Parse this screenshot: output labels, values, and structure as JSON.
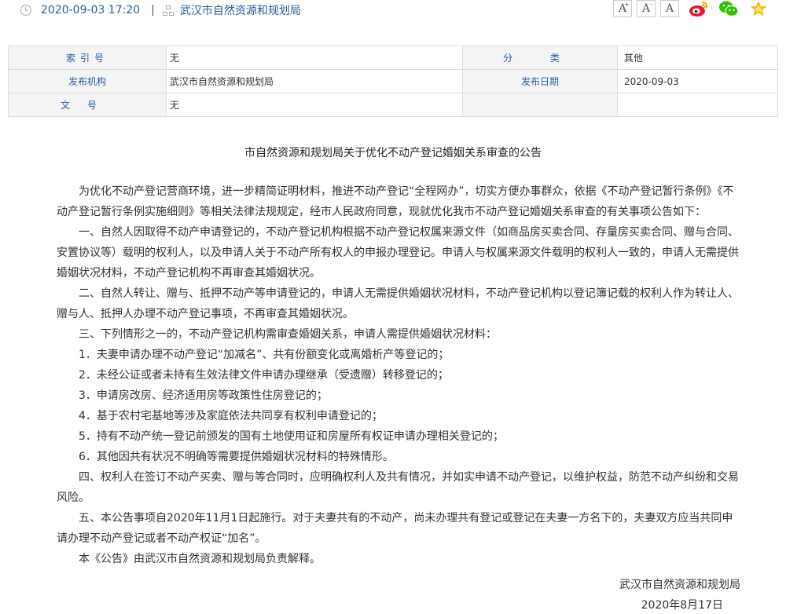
{
  "header": {
    "datetime": "2020-09-03 17:20",
    "separator": "|",
    "publisher": "武汉市自然资源和规划局",
    "font_buttons": [
      {
        "glyph": "A",
        "mark": "+"
      },
      {
        "glyph": "A",
        "mark": "-"
      },
      {
        "glyph": "A",
        "mark": ""
      }
    ],
    "share_icons": [
      "weibo-icon",
      "wechat-icon",
      "favorite-star-icon"
    ],
    "colors": {
      "weibo": "#e6162d",
      "wechat": "#2dc100",
      "star": "#f5b800"
    }
  },
  "info": {
    "index_label": "索引号",
    "index_value": "无",
    "category_label": "分 类",
    "category_value": "其他",
    "issuer_label": "发布机构",
    "issuer_value": "武汉市自然资源和规划局",
    "date_label": "发布日期",
    "date_value": "2020-09-03",
    "docno_label": "文号",
    "docno_value": "无"
  },
  "article": {
    "title": "市自然资源和规划局关于优化不动产登记婚姻关系审查的公告",
    "paragraphs": [
      "为优化不动产登记营商环境，进一步精简证明材料，推进不动产登记“全程网办”，切实方便办事群众，依据《不动产登记暂行条例》《不动产登记暂行条例实施细则》等相关法律法规规定，经市人民政府同意，现就优化我市不动产登记婚姻关系审查的有关事项公告如下：",
      "一、自然人因取得不动产申请登记的，不动产登记机构根据不动产登记权属来源文件（如商品房买卖合同、存量房买卖合同、赠与合同、安置协议等）载明的权利人，以及申请人关于不动产所有权人的申报办理登记。申请人与权属来源文件载明的权利人一致的，申请人无需提供婚姻状况材料，不动产登记机构不再审查其婚姻状况。",
      "二、自然人转让、赠与、抵押不动产等申请登记的，申请人无需提供婚姻状况材料，不动产登记机构以登记簿记载的权利人作为转让人、赠与人、抵押人办理不动产登记事项，不再审查其婚姻状况。",
      "三、下列情形之一的，不动产登记机构需审查婚姻关系，申请人需提供婚姻状况材料：",
      "1．夫妻申请办理不动产登记“加减名”、共有份额变化或离婚析产等登记的；",
      "2．未经公证或者未持有生效法律文件申请办理继承（受遗赠）转移登记的；",
      "3．申请房改房、经济适用房等政策性住房登记的；",
      "4．基于农村宅基地等涉及家庭依法共同享有权利申请登记的；",
      "5．持有不动产统一登记前颁发的国有土地使用证和房屋所有权证申请办理相关登记的；",
      "6．其他因共有状况不明确等需要提供婚姻状况材料的特殊情形。",
      "四、权利人在签订不动产买卖、赠与等合同时，应明确权利人及共有情况，并如实申请不动产登记，以维护权益，防范不动产纠纷和交易风险。",
      "五、本公告事项自2020年11月1日起施行。对于夫妻共有的不动产，尚未办理共有登记或登记在夫妻一方名下的，夫妻双方应当共同申请办理不动产登记或者不动产权证“加名”。",
      "本《公告》由武汉市自然资源和规划局负责解释。"
    ],
    "signature_org": "武汉市自然资源和规划局",
    "signature_date": "2020年8月17日"
  }
}
